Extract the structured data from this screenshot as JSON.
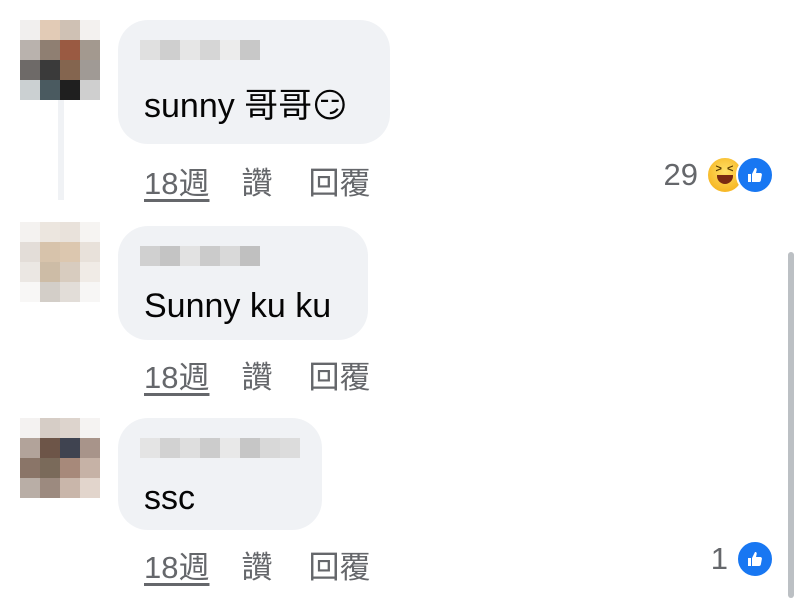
{
  "comments": [
    {
      "text": "sunny 哥哥😏",
      "time": "18週",
      "like_label": "讚",
      "reply_label": "回覆",
      "reaction_count": "29",
      "reactions": [
        "haha-icon",
        "like-icon"
      ]
    },
    {
      "text": "Sunny ku ku",
      "time": "18週",
      "like_label": "讚",
      "reply_label": "回覆"
    },
    {
      "text": "ssc",
      "time": "18週",
      "like_label": "讚",
      "reply_label": "回覆",
      "reaction_count": "1",
      "reactions": [
        "like-icon"
      ]
    }
  ],
  "colors": {
    "bubble": "#f0f2f5",
    "secondary_text": "#65676b",
    "like_blue": "#1877f2"
  }
}
